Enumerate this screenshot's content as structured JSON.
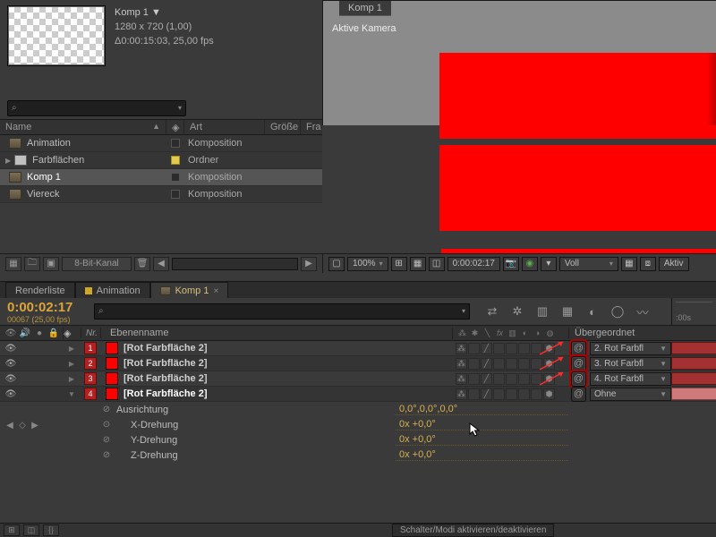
{
  "comp_meta": {
    "title": "Komp 1 ▼",
    "dims": "1280 x 720 (1,00)",
    "dur": "Δ0:00:15:03, 25,00 fps"
  },
  "viewer": {
    "tab": "Komp 1",
    "camera": "Aktive Kamera"
  },
  "viewer_foot": {
    "zoom": "100%",
    "timecode": "0:00:02:17",
    "res": "Voll",
    "aktive": "Aktiv"
  },
  "project": {
    "headers": {
      "name": "Name",
      "art": "Art",
      "size": "Größe",
      "fra": "Fra"
    },
    "rows": [
      {
        "caret": "",
        "icon": "comp",
        "name": "Animation",
        "art": "Komposition",
        "yellow": false,
        "sel": false
      },
      {
        "caret": "▶",
        "icon": "fold",
        "name": "Farbflächen",
        "art": "Ordner",
        "yellow": true,
        "sel": false
      },
      {
        "caret": "",
        "icon": "comp",
        "name": "Komp 1",
        "art": "Komposition",
        "yellow": false,
        "sel": true
      },
      {
        "caret": "",
        "icon": "comp",
        "name": "Viereck",
        "art": "Komposition",
        "yellow": false,
        "sel": false
      }
    ]
  },
  "proj_foot": {
    "bit": "8-Bit-Kanal"
  },
  "tabs": {
    "render": "Renderliste",
    "anim": "Animation",
    "komp": "Komp 1"
  },
  "tl": {
    "tc": "0:00:02:17",
    "frame": "00067 (25,00 fps)",
    "ruler_start": ":00s",
    "cols": {
      "nr": "Nr.",
      "layer": "Ebenenname",
      "parent": "Übergeordnet"
    }
  },
  "layers": [
    {
      "num": "1",
      "name": "[Rot Farbfläche 2]",
      "parent": "2. Rot Farbfl",
      "ring": true,
      "sel": false,
      "last": false
    },
    {
      "num": "2",
      "name": "[Rot Farbfläche 2]",
      "parent": "3. Rot Farbfl",
      "ring": true,
      "sel": false,
      "last": false
    },
    {
      "num": "3",
      "name": "[Rot Farbfläche 2]",
      "parent": "4. Rot Farbfl",
      "ring": true,
      "sel": false,
      "last": false
    },
    {
      "num": "4",
      "name": "[Rot Farbfläche 2]",
      "parent": "Ohne",
      "ring": false,
      "sel": true,
      "last": true
    }
  ],
  "props": {
    "orient": {
      "name": "Ausrichtung",
      "val": "0,0°,0,0°,0,0°"
    },
    "xrot": {
      "name": "X-Drehung",
      "val": "0x +0,0°"
    },
    "yrot": {
      "name": "Y-Drehung",
      "val": "0x +0,0°"
    },
    "zrot": {
      "name": "Z-Drehung",
      "val": "0x +0,0°"
    }
  },
  "bottom": {
    "toggle": "Schalter/Modi aktivieren/deaktivieren"
  }
}
